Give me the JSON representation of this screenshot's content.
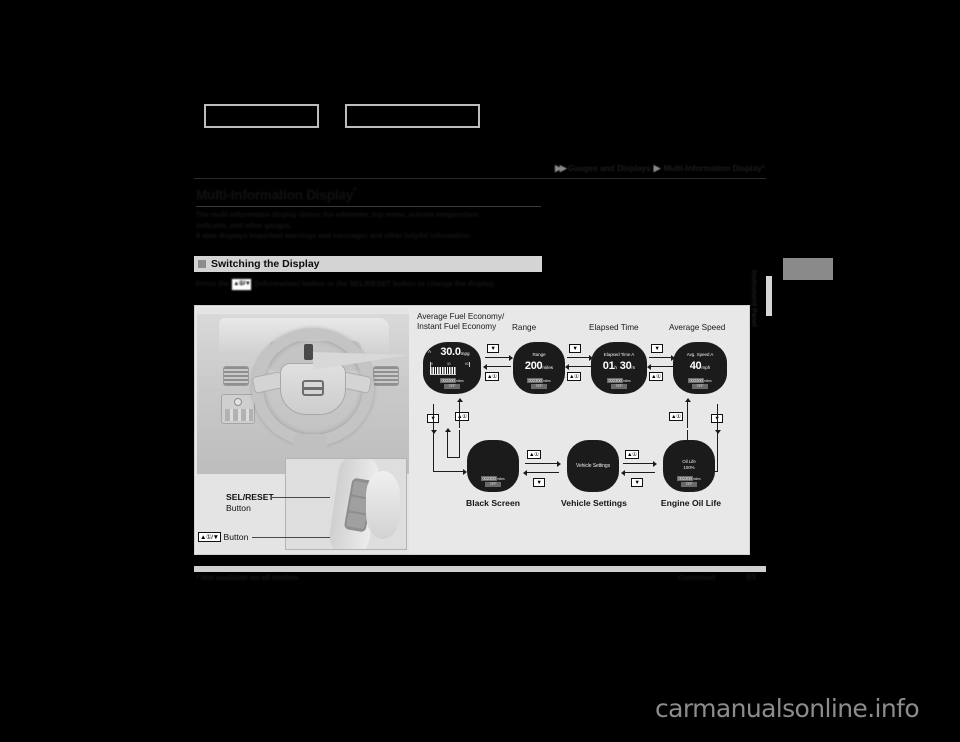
{
  "breadcrumb": {
    "arrows_icon": "double-chevron-right-icon",
    "level1": "Gauges and Displays",
    "separator_icon": "chevron-right-icon",
    "level2": "Multi-Information Display*"
  },
  "heading": {
    "title": "Multi-Information Display",
    "star": "*",
    "intro_line1": "The multi-information display shows the odometer, trip meter, outside temperature",
    "intro_line2": "indicator, and other gauges.",
    "intro_line3": "It also displays important warnings and messages and other helpful information."
  },
  "section": {
    "square_icon": "filled-square-icon",
    "title": "Switching the Display",
    "instruction_pre": "Press the",
    "instruction_button": "▲①/▼",
    "instruction_mid": "(information) button or the",
    "instruction_selreset": "SEL/RESET",
    "instruction_post": "button to change the",
    "instruction_line2": "display."
  },
  "figure": {
    "callouts": {
      "selreset_label_line1": "SEL/RESET",
      "selreset_label_line2": "Button",
      "arrow_button_icon": "▲①/▼",
      "arrow_button_label": "Button"
    },
    "top_row": [
      {
        "label_line1": "Average Fuel Economy/",
        "label_line2": "Instant Fuel Economy",
        "screen": {
          "prefix": "A",
          "value": "30.0",
          "unit": "mpg",
          "gauge_ticks": [
            "0",
            "30",
            "60"
          ],
          "odometer": "002300",
          "odometer_unit": "miles",
          "temperature": "73°F"
        }
      },
      {
        "label_line1": "Range",
        "label_line2": "",
        "screen": {
          "title": "Range",
          "value": "200",
          "unit": "miles",
          "odometer": "002300",
          "odometer_unit": "miles",
          "temperature": "73°F"
        }
      },
      {
        "label_line1": "Elapsed Time",
        "label_line2": "",
        "screen": {
          "title": "Elapsed Time A",
          "value_h": "01",
          "unit_h": "h",
          "value_m": "30",
          "unit_m": "m",
          "odometer": "002300",
          "odometer_unit": "miles",
          "temperature": "73°F"
        }
      },
      {
        "label_line1": "Average Speed",
        "label_line2": "",
        "screen": {
          "title": "Avg. Speed A",
          "value": "40",
          "unit": "mph",
          "odometer": "002300",
          "odometer_unit": "miles",
          "temperature": "73°F"
        }
      }
    ],
    "bottom_row": [
      {
        "label": "Black Screen",
        "screen": {
          "title": "",
          "odometer": "002300",
          "odometer_unit": "miles",
          "temperature": "73°F"
        }
      },
      {
        "label": "Vehicle Settings",
        "screen": {
          "title": "Vehicle Settings",
          "odometer": "",
          "odometer_unit": "",
          "temperature": ""
        }
      },
      {
        "label": "Engine Oil Life",
        "screen": {
          "title": "Oil Life",
          "value": "100%",
          "odometer": "002300",
          "odometer_unit": "miles",
          "temperature": "73°F"
        }
      }
    ],
    "buttons": {
      "down": "▼",
      "up_info": "▲①"
    }
  },
  "side_tab": {
    "text": "Instrument Panel"
  },
  "footer": {
    "footnote": "* Not available on all models",
    "continued": "Continued",
    "page_number": "93"
  },
  "watermark": "carmanualsonline.info"
}
